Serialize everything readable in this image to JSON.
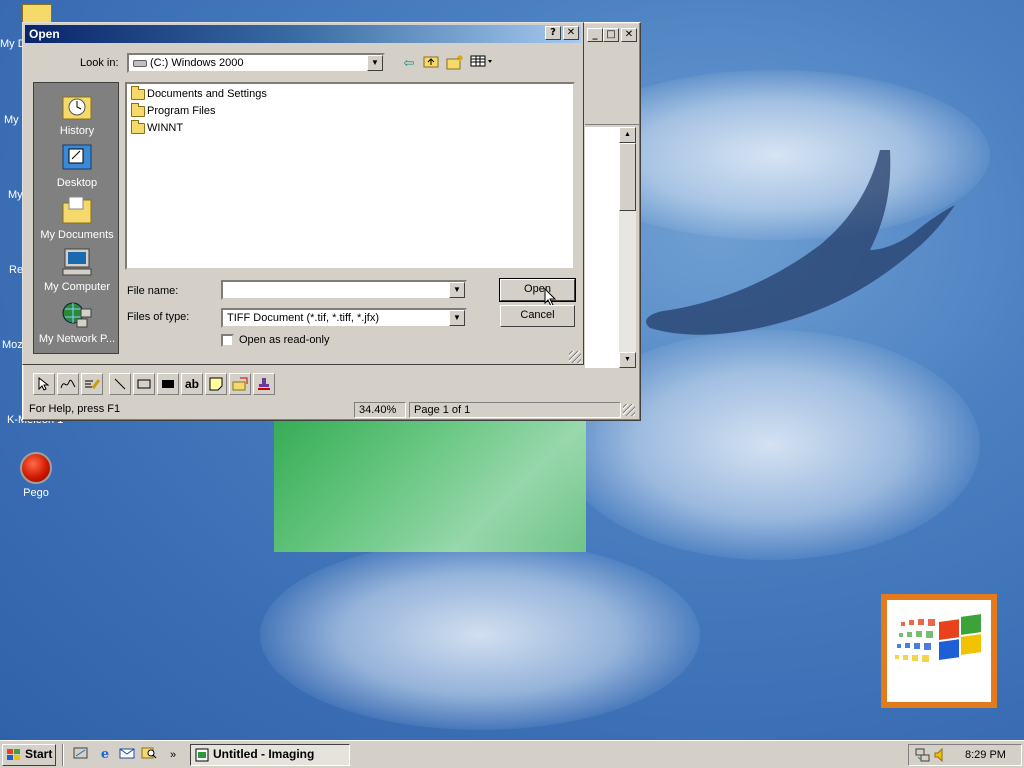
{
  "desktop": {
    "icons": [
      {
        "label": "My D",
        "name": "desktop-my-documents"
      },
      {
        "label": "My",
        "name": "desktop-my-computer"
      },
      {
        "label": "My",
        "name": "desktop-my-network"
      },
      {
        "label": "Re",
        "name": "desktop-recycle-bin"
      },
      {
        "label": "Moz",
        "name": "desktop-mozilla"
      },
      {
        "label": "K-Meleon 1",
        "name": "desktop-k-meleon"
      },
      {
        "label": "Pego",
        "name": "desktop-pego"
      }
    ]
  },
  "app": {
    "title": "Untitled - Imaging",
    "status": {
      "help": "For Help, press F1",
      "zoom": "34.40%",
      "page": "Page 1 of 1"
    },
    "tools": [
      "select-tool-icon",
      "freehand-line-icon",
      "highlighter-icon",
      "straight-line-icon",
      "hollow-rectangle-icon",
      "filled-rectangle-icon",
      "text-tool-icon",
      "attach-a-note-icon",
      "text-from-file-icon",
      "rubber-stamp-icon"
    ],
    "tool_text": {
      "text": "ab"
    }
  },
  "dialog": {
    "title": "Open",
    "help_btn": "?",
    "close_btn": "✕",
    "look_in_label": "Look in:",
    "look_in_value": "(C:) Windows 2000",
    "places": [
      "History",
      "Desktop",
      "My Documents",
      "My Computer",
      "My Network P..."
    ],
    "files": [
      "Documents and Settings",
      "Program Files",
      "WINNT"
    ],
    "file_name_label": "File name:",
    "file_name_value": "",
    "file_type_label": "Files of type:",
    "file_type_value": "TIFF Document (*.tif, *.tiff, *.jfx)",
    "readonly_label": "Open as read-only",
    "open_btn": "Open",
    "cancel_btn": "Cancel"
  },
  "taskbar": {
    "start": "Start",
    "task": "Untitled - Imaging",
    "clock": "8:29 PM",
    "quick_launch": [
      "show-desktop-icon",
      "internet-explorer-icon",
      "outlook-express-icon",
      "search-icon"
    ]
  },
  "colors": {
    "title_active": "#0a246a",
    "desktop": "#3a6db4",
    "face": "#d4d0c8"
  }
}
